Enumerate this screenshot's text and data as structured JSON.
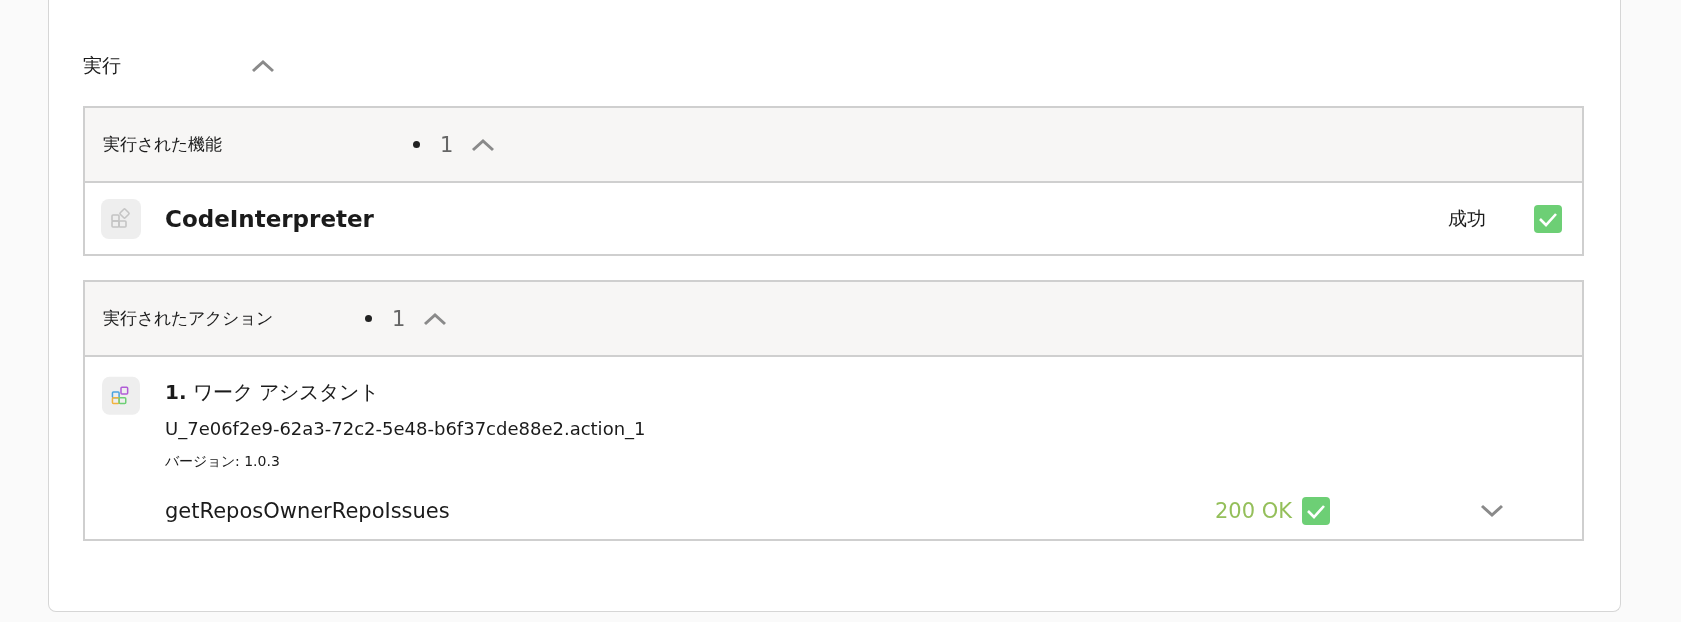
{
  "section": {
    "title": "実行",
    "expanded": true
  },
  "groups": [
    {
      "kind": "features",
      "title": "実行された機能",
      "count": "1",
      "expanded": true,
      "items": [
        {
          "name": "CodeInterpreter",
          "status": "成功",
          "success": true
        }
      ]
    },
    {
      "kind": "actions",
      "title": "実行されたアクション",
      "count": "1",
      "expanded": true,
      "items": [
        {
          "index": "1.",
          "name": "ワーク アシスタント",
          "id": "U_7e06f2e9-62a3-72c2-5e48-b6f37cde88e2.action_1",
          "version_label": "バージョン:",
          "version": "1.0.3",
          "operation": "getReposOwnerRepoIssues",
          "status": "200 OK",
          "success": true,
          "expanded": false
        }
      ]
    }
  ]
}
